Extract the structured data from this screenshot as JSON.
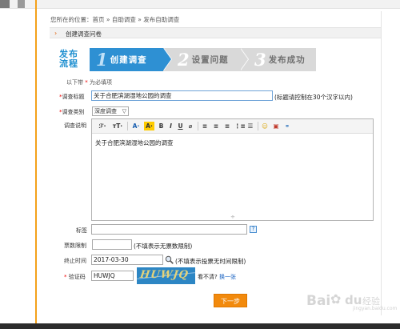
{
  "breadcrumb": {
    "prefix": "您所在的位置：",
    "home": "首页",
    "sep1": "»",
    "section": "自助调查",
    "sep2": "»",
    "current": "发布自助调查"
  },
  "section_bar": {
    "arrow": "›",
    "title": "创建调查问卷"
  },
  "steps": {
    "label_line1": "发布",
    "label_line2": "流程",
    "items": [
      {
        "num": "1",
        "label": "创建调查",
        "active": true
      },
      {
        "num": "2",
        "label": "设置问题",
        "active": false
      },
      {
        "num": "3",
        "label": "发布成功",
        "active": false
      }
    ]
  },
  "required_note": {
    "prefix": "以下带",
    "star": "*",
    "suffix": "为必填项"
  },
  "form": {
    "title": {
      "star": "*",
      "label": "调查标题",
      "value": "关于合肥滨湖湿地公园的调查",
      "hint": "(标题请控制在30个汉字以内)"
    },
    "category": {
      "star": "*",
      "label": "调查类别",
      "value": "深度调查",
      "caret": "▽"
    },
    "description": {
      "label": "调查说明",
      "content": "关于合肥滨湖湿地公园的调查",
      "toolbar": [
        "ℱ·",
        "тT·",
        "A·",
        "A·",
        "B",
        "I",
        "U",
        "⌀",
        "≡",
        "≡",
        "≡",
        "⋮≡",
        "☰",
        "☺",
        "▣",
        "⚭"
      ],
      "resize_glyph": "÷"
    },
    "tags": {
      "label": "标签",
      "value": "",
      "help": "?"
    },
    "vote_limit": {
      "label": "票数限制",
      "value": "",
      "hint": "(不填表示无票数限制)"
    },
    "end_time": {
      "label": "终止时间",
      "value": "2017-03-30",
      "hint": "(不填表示投票无时间限制)"
    },
    "captcha": {
      "star": "*",
      "label": "验证码",
      "value": "HUWJQ",
      "image_text": "HUWJQ",
      "refresh_prefix": "看不清?",
      "refresh_link": "换一张"
    }
  },
  "next_button": "下一步",
  "watermark": {
    "bai": "Bai",
    "paw": "✿",
    "du": "du",
    "jy": "经验",
    "url": "jingyan.baidu.com"
  },
  "colors": {
    "accent_blue": "#2e90d3",
    "step_inactive": "#d9d9d9",
    "button_orange": "#f28a0d",
    "required_red": "#ee0000",
    "highlight_yellow": "#ffcc00"
  }
}
